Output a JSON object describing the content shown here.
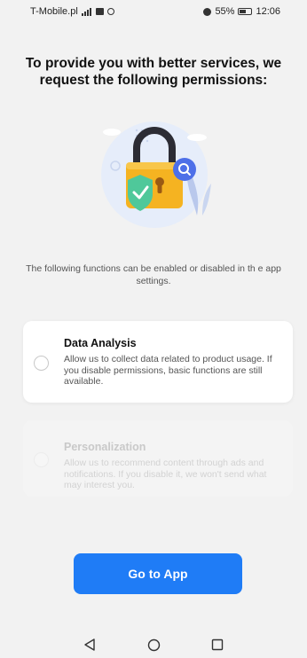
{
  "status_bar": {
    "carrier": "T-Mobile.pl",
    "battery_percent": "55%",
    "time": "12:06"
  },
  "title": "To provide you with better services, we request the following permissions:",
  "note": "The following functions can be enabled or disabled in th e app settings.",
  "permissions": [
    {
      "title": "Data Analysis",
      "description": "Allow us to collect data related to product usage. If you disable permissions, basic functions are still available.",
      "enabled": true
    },
    {
      "title": "Personalization",
      "description": "Allow us to recommend content through ads and notifications. If you disable it, we won't send what may interest you.",
      "enabled": false
    }
  ],
  "primary_button": "Go to App",
  "colors": {
    "accent": "#1f7cf6",
    "background": "#f2f2f2",
    "lock_body": "#f5b321",
    "shield": "#4fc89a"
  }
}
